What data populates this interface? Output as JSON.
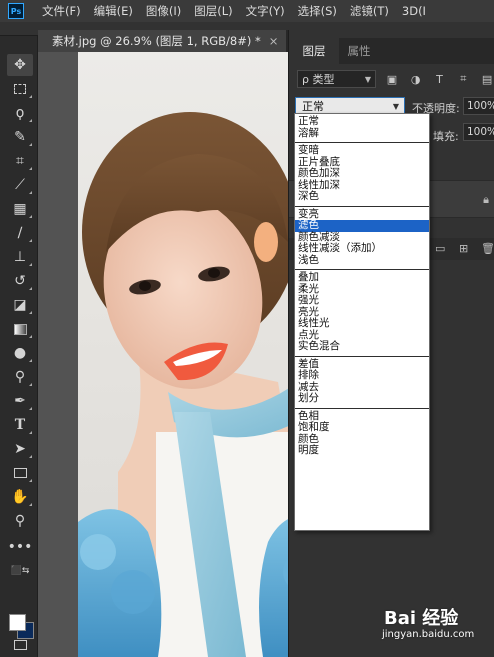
{
  "app": {
    "logo": "Ps"
  },
  "menubar": {
    "items": [
      "文件(F)",
      "编辑(E)",
      "图像(I)",
      "图层(L)",
      "文字(Y)",
      "选择(S)",
      "滤镜(T)",
      "3D(I"
    ]
  },
  "document": {
    "tab_title": "素材.jpg @ 26.9% (图层 1, RGB/8#) *",
    "close": "×"
  },
  "toolbar": {
    "tools": [
      "move-tool",
      "marquee-tool",
      "lasso-tool",
      "quick-select-tool",
      "crop-tool",
      "eyedropper-tool",
      "healing-brush-tool",
      "brush-tool",
      "clone-stamp-tool",
      "history-brush-tool",
      "eraser-tool",
      "gradient-tool",
      "blur-tool",
      "dodge-tool",
      "pen-tool",
      "type-tool",
      "path-select-tool",
      "rectangle-tool",
      "hand-tool",
      "zoom-tool",
      "more-tools"
    ],
    "foreground_color": "#ffffff",
    "background_color": "#0a2a5a"
  },
  "layers_panel": {
    "tabs": [
      "图层",
      "属性"
    ],
    "filter_label": "ρ 类型",
    "blend_mode": "正常",
    "opacity_label": "不透明度:",
    "opacity_value": "100%",
    "fill_label": "填充:",
    "fill_value": "100%"
  },
  "blend_dropdown": {
    "groups": [
      [
        "正常",
        "溶解"
      ],
      [
        "变暗",
        "正片叠底",
        "颜色加深",
        "线性加深",
        "深色"
      ],
      [
        "变亮",
        "滤色",
        "颜色减淡",
        "线性减淡（添加）",
        "浅色"
      ],
      [
        "叠加",
        "柔光",
        "强光",
        "亮光",
        "线性光",
        "点光",
        "实色混合"
      ],
      [
        "差值",
        "排除",
        "减去",
        "划分"
      ],
      [
        "色相",
        "饱和度",
        "颜色",
        "明度"
      ]
    ],
    "selected": "滤色",
    "highlight_color": "#1c63c6"
  },
  "watermark": {
    "brand": "Bai 经验",
    "url": "jingyan.baidu.com"
  }
}
